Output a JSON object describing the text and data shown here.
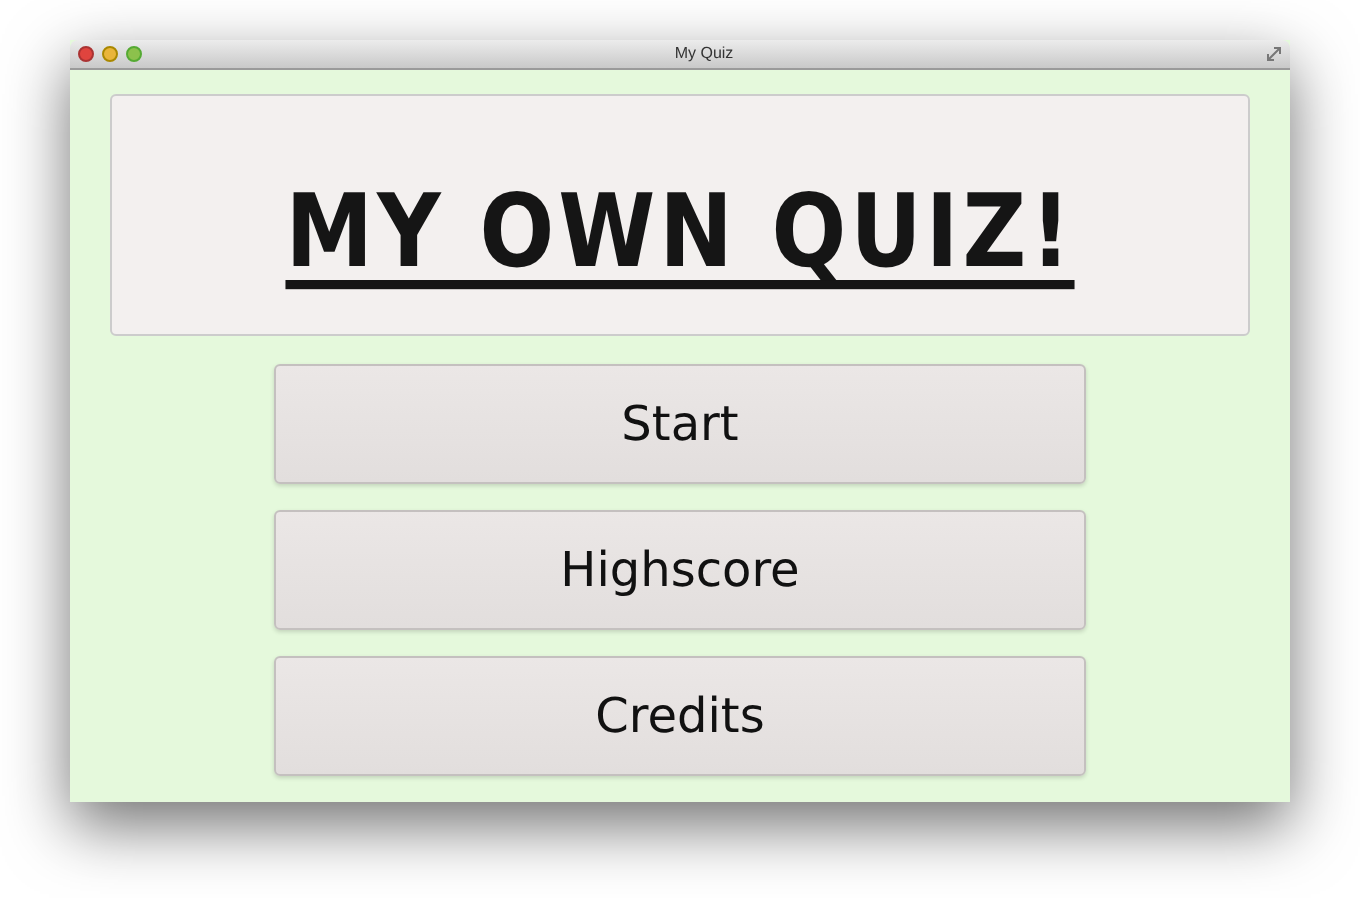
{
  "window": {
    "title": "My Quiz"
  },
  "banner": {
    "title": "MY OWN QUIZ!"
  },
  "buttons": [
    "Start",
    "Highscore",
    "Credits"
  ]
}
